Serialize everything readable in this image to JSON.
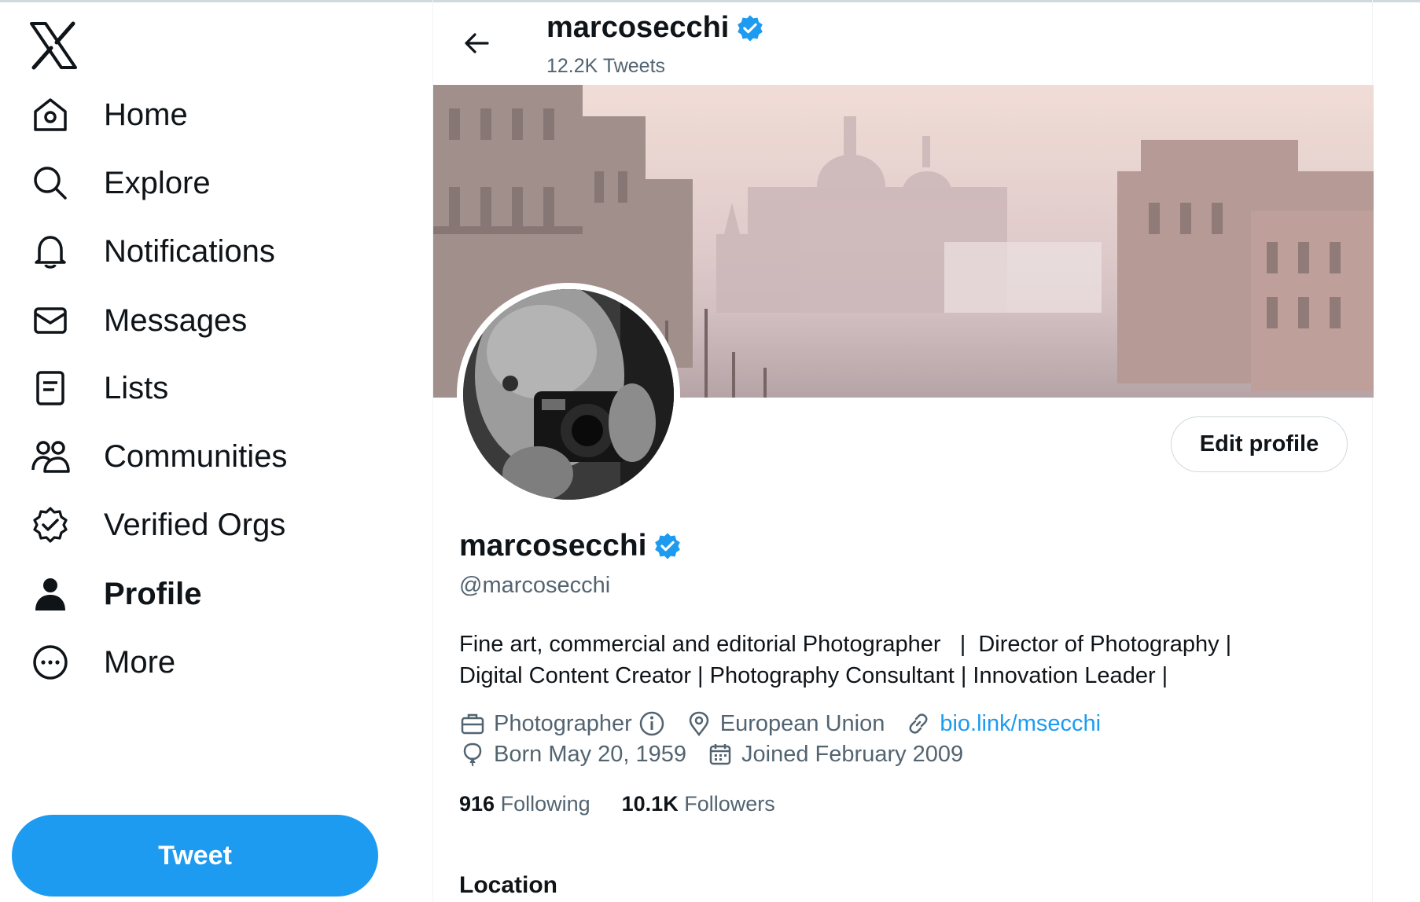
{
  "sidebar": {
    "logo": "x-logo-icon",
    "items": [
      {
        "label": "Home",
        "icon": "home-icon"
      },
      {
        "label": "Explore",
        "icon": "search-icon"
      },
      {
        "label": "Notifications",
        "icon": "bell-icon"
      },
      {
        "label": "Messages",
        "icon": "envelope-icon"
      },
      {
        "label": "Lists",
        "icon": "list-icon"
      },
      {
        "label": "Communities",
        "icon": "communities-icon"
      },
      {
        "label": "Verified Orgs",
        "icon": "verified-badge-icon"
      },
      {
        "label": "Profile",
        "icon": "person-icon",
        "active": true
      },
      {
        "label": "More",
        "icon": "more-circle-icon"
      }
    ],
    "tweet_button": "Tweet"
  },
  "header": {
    "name": "marcosecchi",
    "tweet_count": "12.2K Tweets"
  },
  "profile": {
    "name": "marcosecchi",
    "handle": "@marcosecchi",
    "edit_button": "Edit profile",
    "bio_line1": "Fine art, commercial and editorial Photographer   |  Director of Photography |",
    "bio_line2": "Digital Content Creator | Photography Consultant | Innovation Leader |",
    "profession": "Photographer",
    "location": "European Union",
    "link": "bio.link/msecchi",
    "born": "Born May 20, 1959",
    "joined": "Joined February 2009",
    "following_count": "916",
    "following_label": "Following",
    "followers_count": "10.1K",
    "followers_label": "Followers",
    "section_title": "Location"
  },
  "colors": {
    "accent": "#1d9bf0",
    "text_primary": "#0f1419",
    "text_secondary": "#536471"
  }
}
